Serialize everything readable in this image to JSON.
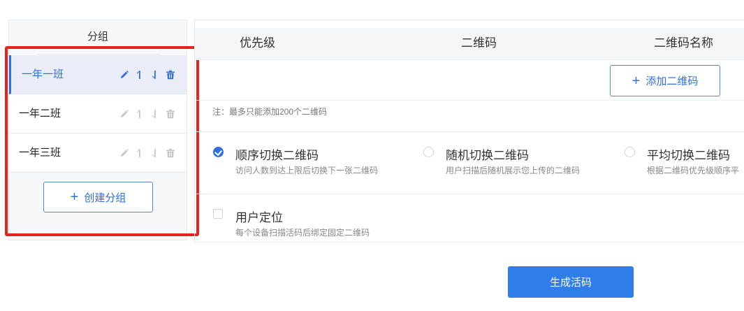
{
  "group_panel": {
    "header": "分组",
    "items": [
      {
        "label": "一年一班",
        "active": true
      },
      {
        "label": "一年二班",
        "active": false
      },
      {
        "label": "一年三班",
        "active": false
      }
    ],
    "create_button": {
      "icon": "plus-icon",
      "label": "创建分组"
    }
  },
  "table": {
    "columns": [
      "优先级",
      "二维码",
      "二维码名称"
    ]
  },
  "add_qr_button": {
    "icon": "plus-icon",
    "label": "添加二维码"
  },
  "note": "注：最多只能添加200个二维码",
  "switch_modes": [
    {
      "title": "顺序切换二维码",
      "desc": "访问人数到达上限后切换下一张二维码",
      "checked": true
    },
    {
      "title": "随机切换二维码",
      "desc": "用户扫描后随机展示您上传的二维码",
      "checked": false
    },
    {
      "title": "平均切换二维码",
      "desc": "根据二维码优先级顺序平",
      "checked": false
    }
  ],
  "user_location": {
    "title": "用户定位",
    "desc": "每个设备扫描活码后绑定固定二维码",
    "checked": false
  },
  "generate_button": {
    "label": "生成活码"
  },
  "colors": {
    "accent": "#2f6fde",
    "primary_button": "#2f7de8",
    "highlight_border": "#e8221c",
    "active_item_bg": "#eaedf7",
    "disabled_icon": "#c4c7cc"
  }
}
